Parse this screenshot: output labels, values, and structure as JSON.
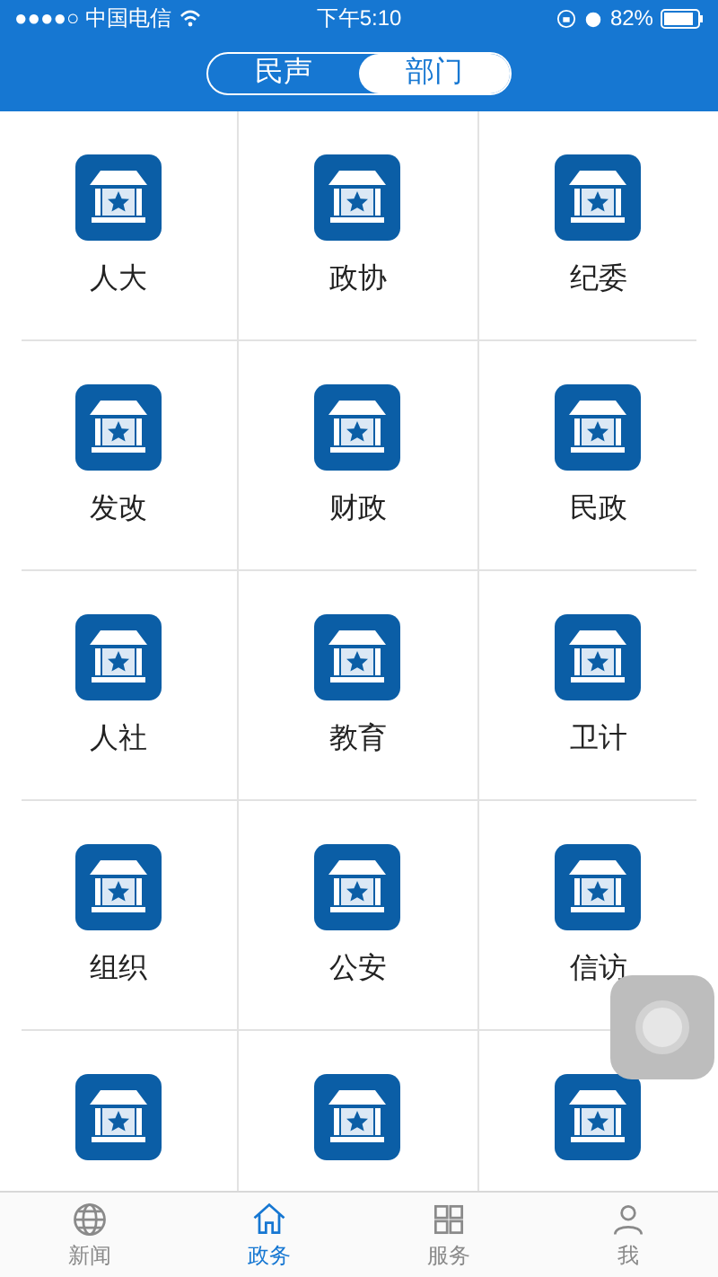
{
  "status_bar": {
    "carrier": "●●●●○ 中国电信",
    "time": "下午5:10",
    "battery": "82%"
  },
  "segments": [
    {
      "label": "民声",
      "selected": false
    },
    {
      "label": "部门",
      "selected": true
    }
  ],
  "departments": [
    {
      "kind": "labeled",
      "label": "人大"
    },
    {
      "kind": "labeled",
      "label": "政协"
    },
    {
      "kind": "labeled",
      "label": "纪委"
    },
    {
      "kind": "labeled",
      "label": "发改"
    },
    {
      "kind": "labeled",
      "label": "财政"
    },
    {
      "kind": "labeled",
      "label": "民政"
    },
    {
      "kind": "labeled",
      "label": "人社"
    },
    {
      "kind": "labeled",
      "label": "教育"
    },
    {
      "kind": "labeled",
      "label": "卫计"
    },
    {
      "kind": "labeled",
      "label": "组织"
    },
    {
      "kind": "labeled",
      "label": "公安"
    },
    {
      "kind": "labeled",
      "label": "信访"
    },
    {
      "kind": "icon_only"
    },
    {
      "kind": "icon_only"
    },
    {
      "kind": "icon_only"
    }
  ],
  "tab_bar": [
    {
      "label": "新闻",
      "kind": "globe",
      "selected": false
    },
    {
      "label": "政务",
      "kind": "home",
      "selected": true
    },
    {
      "label": "服务",
      "kind": "grid",
      "selected": false
    },
    {
      "label": "我",
      "kind": "person",
      "selected": false
    }
  ]
}
